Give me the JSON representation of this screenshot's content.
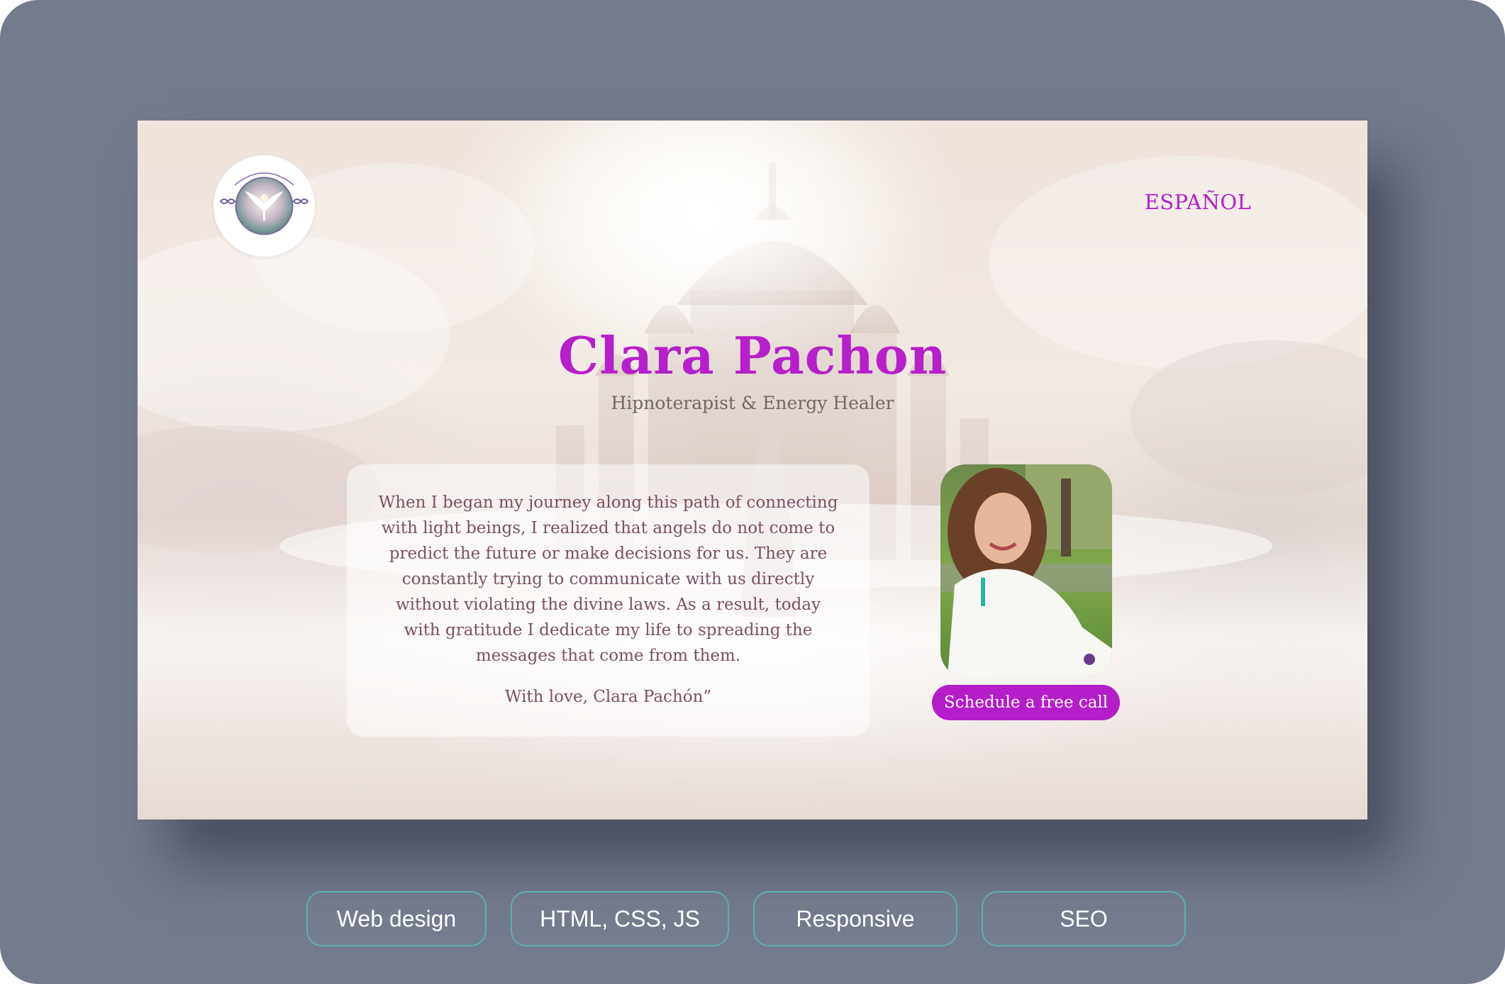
{
  "site": {
    "logo_alt": "clara reconexión divina",
    "language_link": "ESPAÑOL",
    "name": "Clara Pachon",
    "role": "Hipnoterapist & Energy Healer",
    "quote": "When I began my journey along this path of connecting with light beings, I realized that angels do not come to predict the future or make decisions for us. They are constantly trying to communicate with us directly without violating the divine laws. As a result, today with gratitude I dedicate my life to spreading the messages that come from them.",
    "signature": "With love, Clara Pachón”",
    "cta_label": "Schedule a free call"
  },
  "tags": [
    "Web design",
    "HTML, CSS, JS",
    "Responsive",
    "SEO"
  ],
  "colors": {
    "frame": "#747b8c",
    "accent": "#b620c9",
    "tag_border": "#5fb0ad",
    "quote_text": "#7c4f66"
  },
  "icons": {
    "logo": "angel-wings-logo-icon",
    "infinity": "infinity-icon"
  }
}
